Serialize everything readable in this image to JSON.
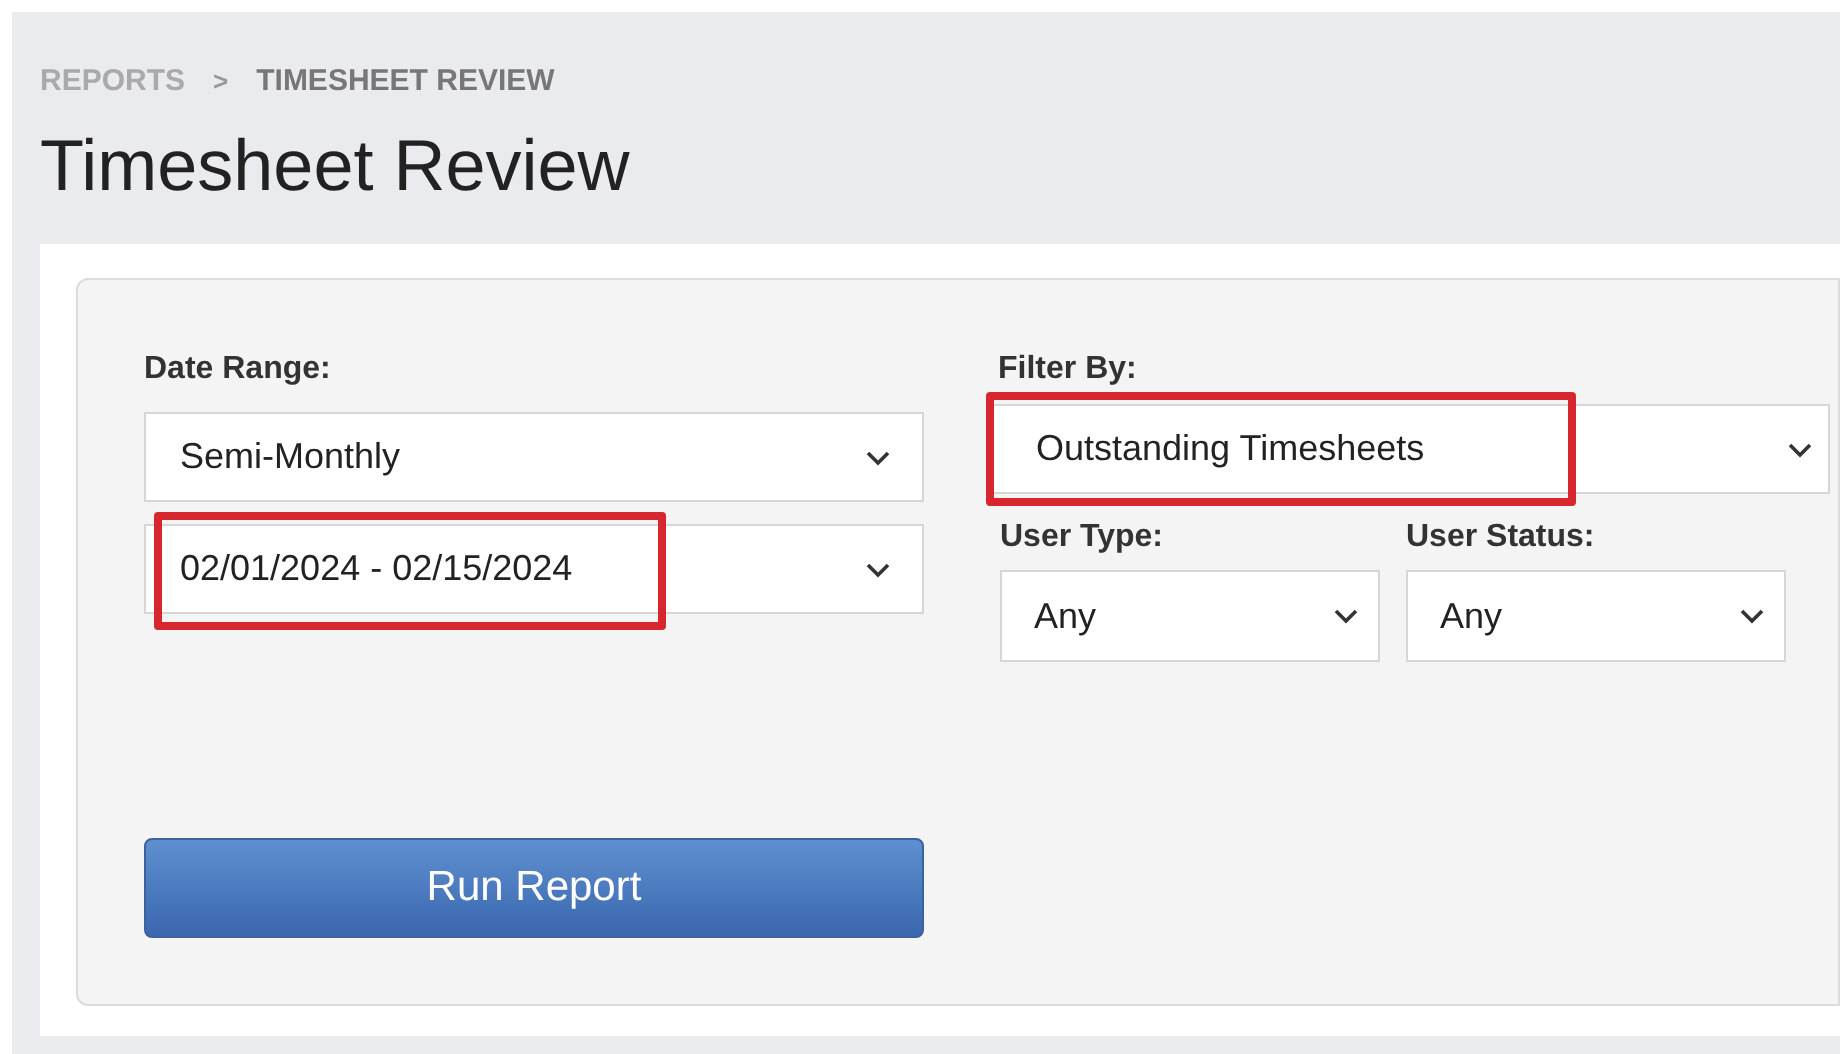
{
  "breadcrumb": [
    {
      "label": "REPORTS",
      "current": false
    },
    {
      "label": "TIMESHEET REVIEW",
      "current": true
    }
  ],
  "breadcrumb_separator": ">",
  "title": "Timesheet Review",
  "date_range": {
    "label": "Date Range:",
    "selects": [
      {
        "value": "Semi-Monthly",
        "highlighted": false
      },
      {
        "value": "02/01/2024 - 02/15/2024",
        "highlighted": true
      }
    ]
  },
  "filter_by": {
    "label": "Filter By:",
    "value": "Outstanding Timesheets",
    "highlighted": true
  },
  "user_type": {
    "label": "User Type:",
    "value": "Any"
  },
  "user_status": {
    "label": "User Status:",
    "value": "Any"
  },
  "run_button": "Run Report"
}
